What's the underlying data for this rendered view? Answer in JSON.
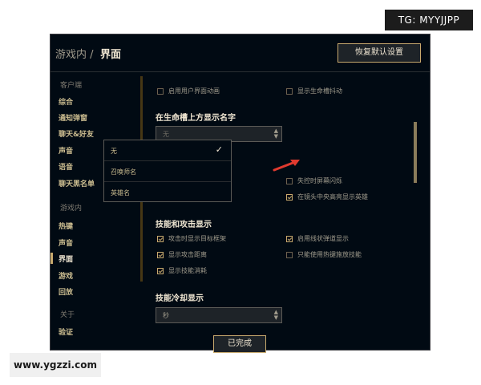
{
  "watermarks": {
    "top": "TG: MYYJJPP",
    "bottom": "www.ygzzi.com"
  },
  "header": {
    "breadcrumb_prefix": "游戏内 /",
    "breadcrumb_current": "界面",
    "restore_label": "恢复默认设置"
  },
  "sidebar": {
    "section_client": "客户端",
    "client_items": [
      "综合",
      "通知弹窗",
      "聊天&好友",
      "声音",
      "语音",
      "聊天黑名单"
    ],
    "section_ingame": "游戏内",
    "ingame_items": [
      "热键",
      "声音",
      "界面",
      "游戏",
      "回放"
    ],
    "active_item": "界面",
    "section_about": "关于",
    "about_items": [
      "验证"
    ]
  },
  "options": {
    "enable_ui_animation": {
      "label": "启用用户界面动画",
      "checked": false
    },
    "show_health_shake": {
      "label": "显示生命槽抖动",
      "checked": false
    },
    "lose_control_flash": {
      "label": "失控时屏幕闪烁",
      "checked": false
    },
    "camera_highlight": {
      "label": "在镜头中央高亮显示英雄",
      "checked": true
    },
    "show_target_frame": {
      "label": "攻击时显示目标框架",
      "checked": true
    },
    "show_line_missile": {
      "label": "启用线状弹道显示",
      "checked": true
    },
    "show_attack_range": {
      "label": "显示攻击距离",
      "checked": true
    },
    "only_hotkey_cast": {
      "label": "只能使用热键施放技能",
      "checked": false
    },
    "show_ability_cost": {
      "label": "显示技能消耗",
      "checked": true
    }
  },
  "name_section": {
    "title": "在生命槽上方显示名字",
    "select_value": "无",
    "dropdown_options": [
      "无",
      "召唤师名",
      "英雄名"
    ],
    "selected_option": "无"
  },
  "skills_section": {
    "title": "技能和攻击显示"
  },
  "cooldown_section": {
    "title": "技能冷却显示",
    "select_value": "秒"
  },
  "footer": {
    "done_label": "已完成"
  },
  "colors": {
    "accent_gold": "#c8aa6e",
    "window_bg": "#010a13",
    "annotation_red": "#e03a2f"
  }
}
